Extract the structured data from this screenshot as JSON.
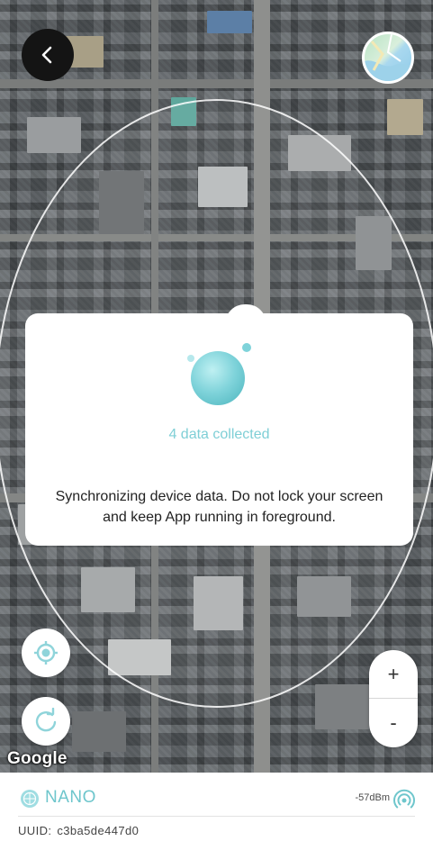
{
  "map": {
    "attribution": "Google",
    "colors": {
      "range_circle": "#ffffff",
      "modal_accent": "#7fcfd6"
    }
  },
  "controls": {
    "back_icon": "chevron-left-icon",
    "layer_icon": "map-layer-icon",
    "locate_icon": "crosshair-icon",
    "refresh_icon": "refresh-icon",
    "zoom_in_label": "+",
    "zoom_out_label": "-"
  },
  "sync_modal": {
    "collected_text": "4 data collected",
    "message": "Synchronizing device data. Do not lock your screen and keep App running in foreground.",
    "icon": "sync-bubble-icon"
  },
  "device": {
    "name": "NANO",
    "signal": "-57dBm",
    "uuid_label": "UUID:",
    "uuid_value": "c3ba5de447d0",
    "accent_color": "#6ec6cc"
  }
}
